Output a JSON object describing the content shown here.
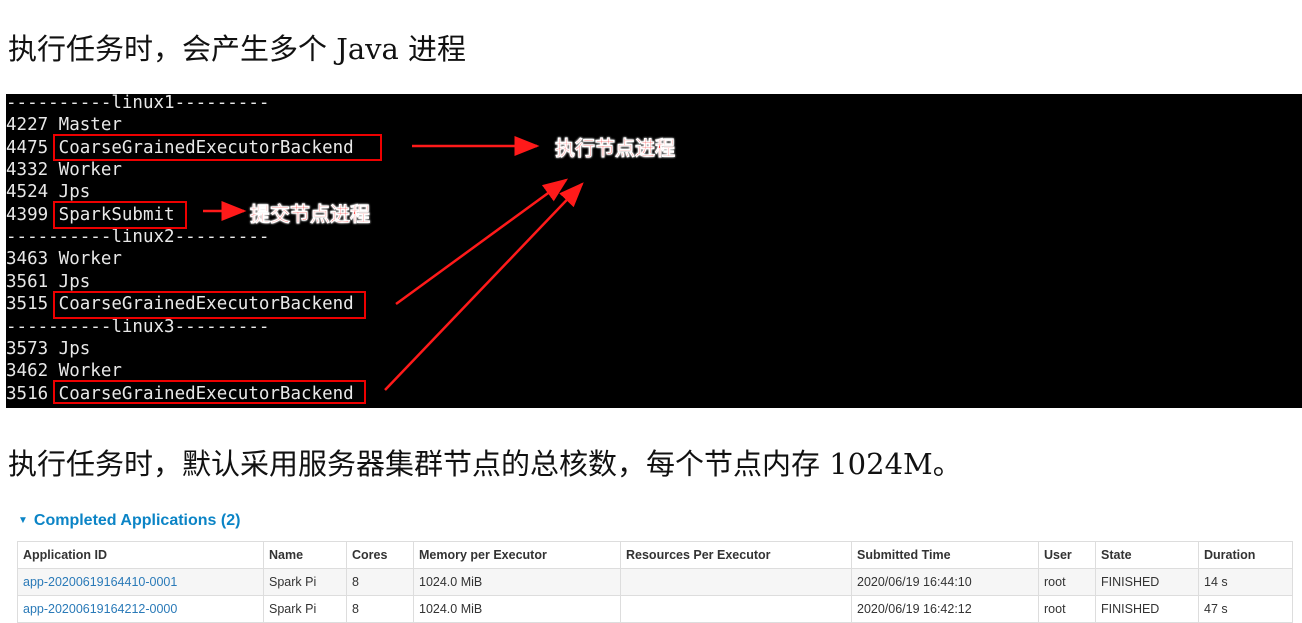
{
  "para1": "执行任务时，会产生多个 Java 进程",
  "terminal": {
    "lines": [
      "----------linux1---------",
      "4227 Master",
      "4475 CoarseGrainedExecutorBackend",
      "4332 Worker",
      "4524 Jps",
      "4399 SparkSubmit",
      "----------linux2---------",
      "3463 Worker",
      "3561 Jps",
      "3515 CoarseGrainedExecutorBackend",
      "----------linux3---------",
      "3573 Jps",
      "3462 Worker",
      "3516 CoarseGrainedExecutorBackend"
    ],
    "annotations": {
      "executor": "执行节点进程",
      "submit": "提交节点进程"
    },
    "highlight_color": "#ff0000"
  },
  "para2": "执行任务时，默认采用服务器集群节点的总核数，每个节点内存 1024M。",
  "section": {
    "title": "Completed Applications (2)"
  },
  "table": {
    "headers": [
      "Application ID",
      "Name",
      "Cores",
      "Memory per Executor",
      "Resources Per Executor",
      "Submitted Time",
      "User",
      "State",
      "Duration"
    ],
    "rows": [
      [
        "app-20200619164410-0001",
        "Spark Pi",
        "8",
        "1024.0 MiB",
        "",
        "2020/06/19 16:44:10",
        "root",
        "FINISHED",
        "14 s"
      ],
      [
        "app-20200619164212-0000",
        "Spark Pi",
        "8",
        "1024.0 MiB",
        "",
        "2020/06/19 16:42:12",
        "root",
        "FINISHED",
        "47 s"
      ]
    ]
  }
}
